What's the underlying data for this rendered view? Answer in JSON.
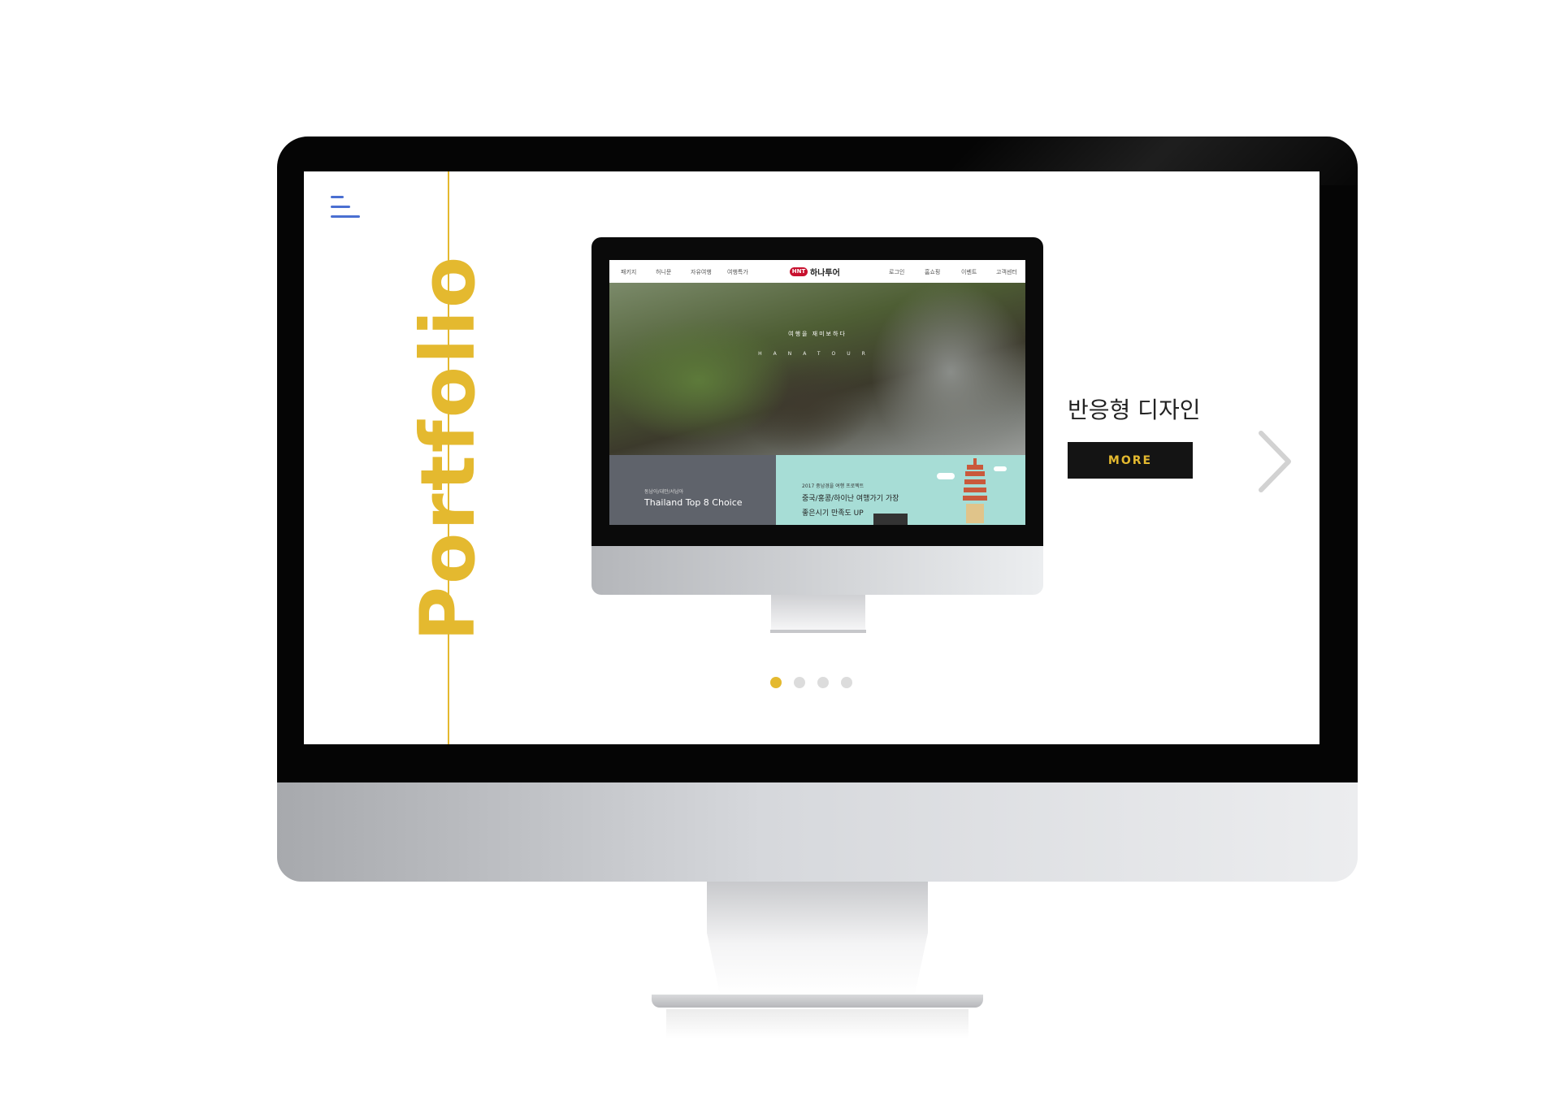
{
  "screen": {
    "title": "Portfolio",
    "subtitle": "반응형 디자인",
    "more_label": "MORE",
    "accent_color": "#e4b92f",
    "menu_icon": "hamburger-icon",
    "next_icon": "chevron-right-icon",
    "pager": {
      "count": 4,
      "active_index": 0
    }
  },
  "preview": {
    "nav_left": [
      "패키지",
      "허니문",
      "자유여행",
      "여행특가"
    ],
    "logo_badge": "HNT",
    "logo_text": "하나투어",
    "nav_right": [
      "로그인",
      "홈쇼핑",
      "이벤트",
      "고객센터"
    ],
    "hero_title": "여행을 재미보하다",
    "hero_sub": "HANATOUR",
    "card_left_small": "동남아/대만/서남아",
    "card_left_title": "Thailand Top 8 Choice",
    "card_right_small": "2017 중남경을 여행 프로젝트",
    "card_right_line1": "중국/홍콩/하이난 여행가기 가장",
    "card_right_line2": "좋은시기 만족도 UP"
  }
}
